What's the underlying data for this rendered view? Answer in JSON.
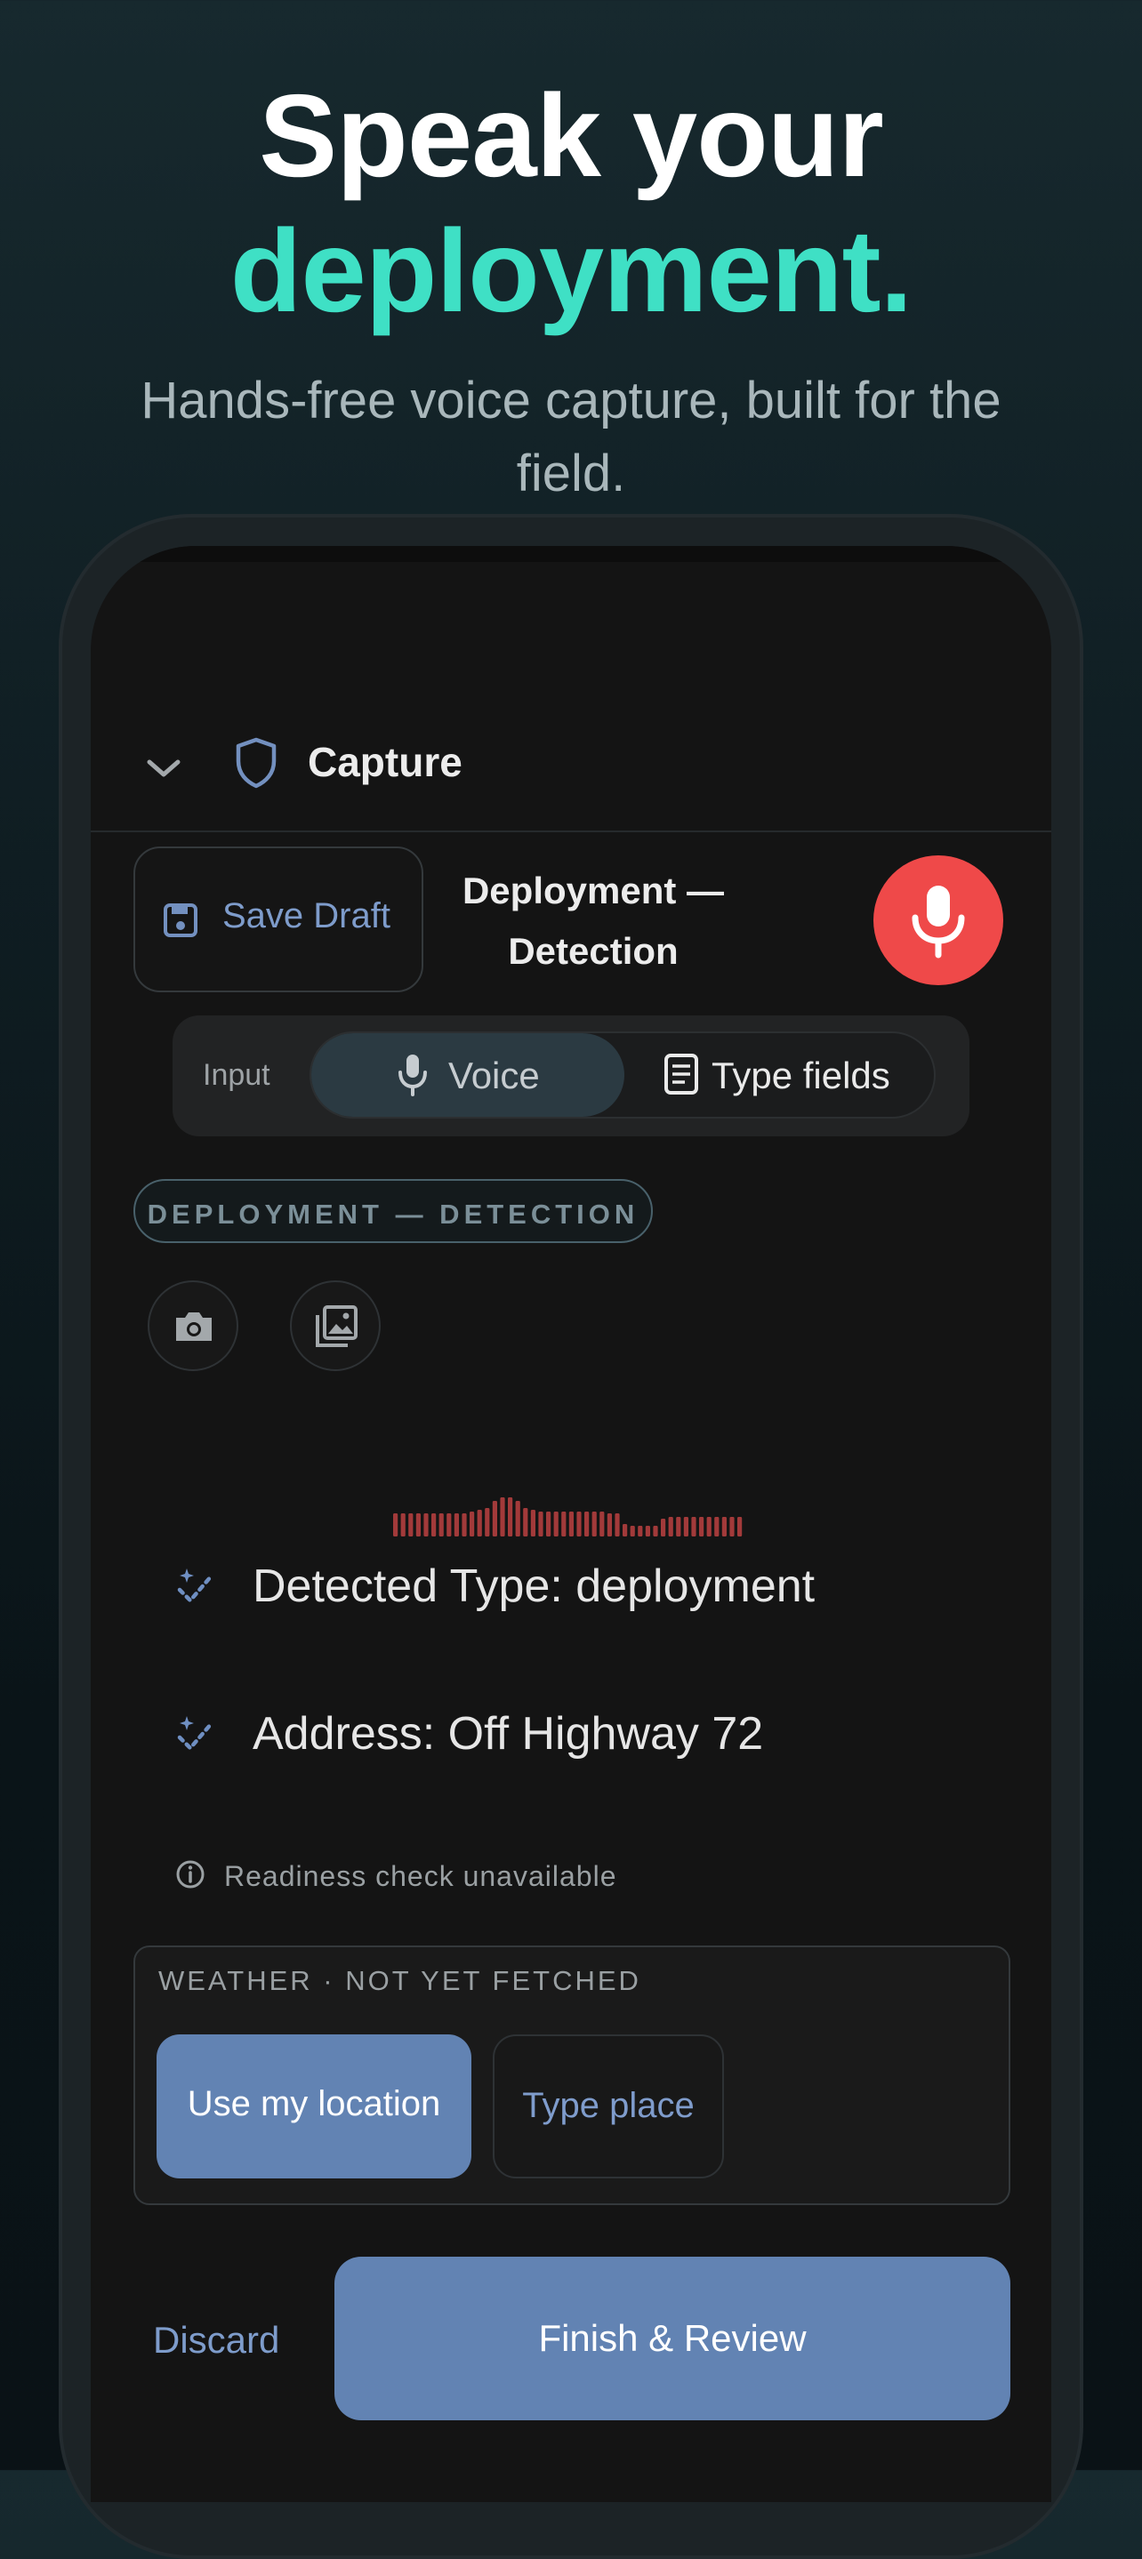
{
  "hero": {
    "line1": "Speak your",
    "line2": "deployment.",
    "subtitle": "Hands-free voice capture, built for the field."
  },
  "header": {
    "collapse_icon": "chevron-down-icon",
    "shield_icon": "shield-icon",
    "title": "Capture"
  },
  "toolbar": {
    "save_draft_label": "Save Draft",
    "save_icon": "floppy-disk-icon",
    "form_title": "Deployment — Detection",
    "mic_icon": "microphone-icon"
  },
  "input_mode": {
    "label": "Input",
    "options": [
      {
        "label": "Voice",
        "icon": "microphone-icon",
        "selected": true
      },
      {
        "label": "Type fields",
        "icon": "document-icon",
        "selected": false
      }
    ]
  },
  "form_chip": "DEPLOYMENT — DETECTION",
  "media": {
    "camera_icon": "camera-icon",
    "gallery_icon": "photo-gallery-icon"
  },
  "fields": [
    {
      "icon": "sparkle-check-icon",
      "text": "Detected Type: deployment"
    },
    {
      "icon": "sparkle-check-icon",
      "text": "Address: Off Highway 72"
    }
  ],
  "readiness": {
    "icon": "info-icon",
    "text": "Readiness check unavailable"
  },
  "weather": {
    "status": "WEATHER · NOT YET FETCHED",
    "use_location_label": "Use my location",
    "type_place_label": "Type place"
  },
  "footer": {
    "discard_label": "Discard",
    "finish_label": "Finish & Review"
  },
  "colors": {
    "accent_teal": "#3fe0c5",
    "record_red": "#ef4949",
    "primary_blue": "#6283b3",
    "link_blue": "#7e9ccb",
    "waveform": "#a23a3a"
  }
}
